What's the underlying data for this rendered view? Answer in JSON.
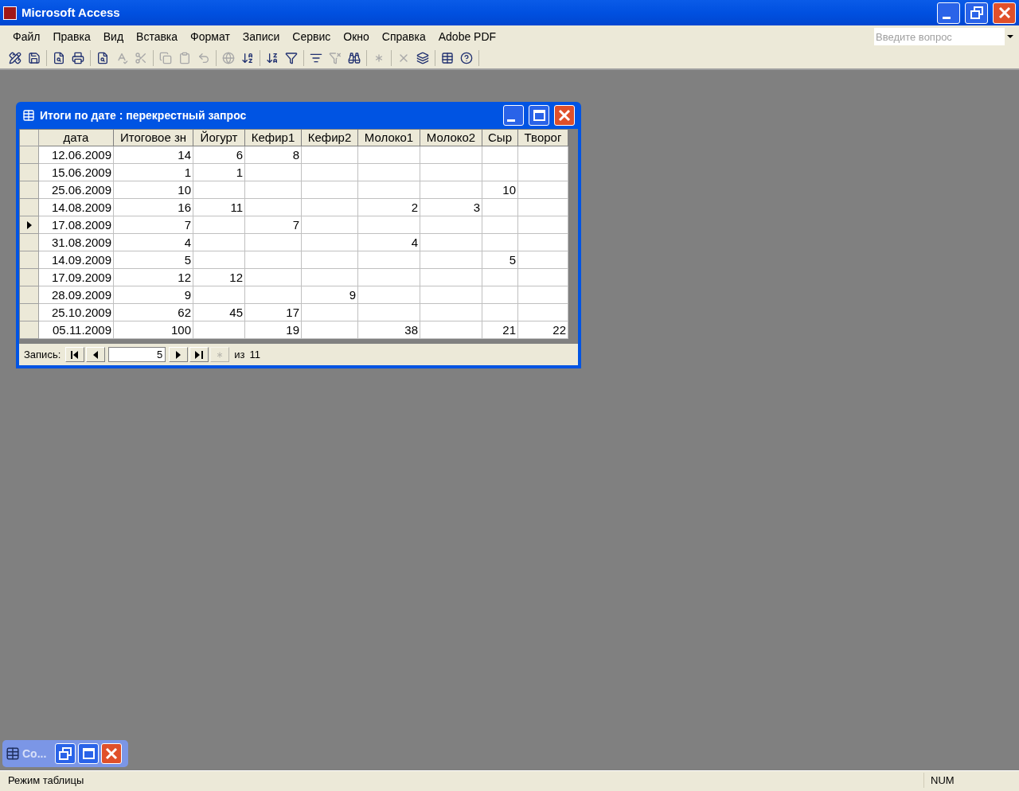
{
  "window": {
    "title": "Microsoft Access"
  },
  "menu": [
    "Файл",
    "Правка",
    "Вид",
    "Вставка",
    "Формат",
    "Записи",
    "Сервис",
    "Окно",
    "Справка",
    "Adobe PDF"
  ],
  "help_search": {
    "placeholder": "Введите вопрос"
  },
  "toolbar": [
    {
      "disabled": false
    },
    {
      "disabled": false
    },
    {
      "disabled": false
    },
    {
      "disabled": false
    },
    {
      "disabled": false
    },
    {
      "disabled": true
    },
    {
      "disabled": true
    },
    {
      "disabled": true
    },
    {
      "disabled": true
    },
    {
      "disabled": true
    },
    {
      "disabled": true
    },
    {
      "disabled": false
    },
    {
      "disabled": false
    },
    {
      "disabled": false
    },
    {
      "disabled": false
    },
    {
      "disabled": true
    },
    {
      "disabled": false
    },
    {
      "disabled": true
    },
    {
      "disabled": true
    },
    {
      "disabled": false
    },
    {
      "disabled": false
    },
    {
      "disabled": false
    }
  ],
  "query_window": {
    "title": "Итоги по дате : перекрестный запрос",
    "columns": [
      "дата",
      "Итоговое зн",
      "Йогурт",
      "Кефир1",
      "Кефир2",
      "Молоко1",
      "Молоко2",
      "Сыр",
      "Творог"
    ],
    "rows": [
      {
        "selected": false,
        "cells": [
          "12.06.2009",
          "14",
          "6",
          "8",
          "",
          "",
          "",
          "",
          ""
        ]
      },
      {
        "selected": false,
        "cells": [
          "15.06.2009",
          "1",
          "1",
          "",
          "",
          "",
          "",
          "",
          ""
        ]
      },
      {
        "selected": false,
        "cells": [
          "25.06.2009",
          "10",
          "",
          "",
          "",
          "",
          "",
          "10",
          ""
        ]
      },
      {
        "selected": false,
        "cells": [
          "14.08.2009",
          "16",
          "11",
          "",
          "",
          "2",
          "3",
          "",
          ""
        ]
      },
      {
        "selected": true,
        "cells": [
          "17.08.2009",
          "7",
          "",
          "7",
          "",
          "",
          "",
          "",
          ""
        ]
      },
      {
        "selected": false,
        "cells": [
          "31.08.2009",
          "4",
          "",
          "",
          "",
          "4",
          "",
          "",
          ""
        ]
      },
      {
        "selected": false,
        "cells": [
          "14.09.2009",
          "5",
          "",
          "",
          "",
          "",
          "",
          "5",
          ""
        ]
      },
      {
        "selected": false,
        "cells": [
          "17.09.2009",
          "12",
          "12",
          "",
          "",
          "",
          "",
          "",
          ""
        ]
      },
      {
        "selected": false,
        "cells": [
          "28.09.2009",
          "9",
          "",
          "",
          "9",
          "",
          "",
          "",
          ""
        ]
      },
      {
        "selected": false,
        "cells": [
          "25.10.2009",
          "62",
          "45",
          "17",
          "",
          "",
          "",
          "",
          ""
        ]
      },
      {
        "selected": false,
        "cells": [
          "05.11.2009",
          "100",
          "",
          "19",
          "",
          "38",
          "",
          "21",
          "22"
        ]
      }
    ],
    "navigator": {
      "label": "Запись:",
      "current": "5",
      "total_label": "из",
      "total": "11"
    }
  },
  "minimized_window": {
    "title": "Co..."
  },
  "status_bar": {
    "text": "Режим таблицы",
    "indicator": "NUM"
  }
}
